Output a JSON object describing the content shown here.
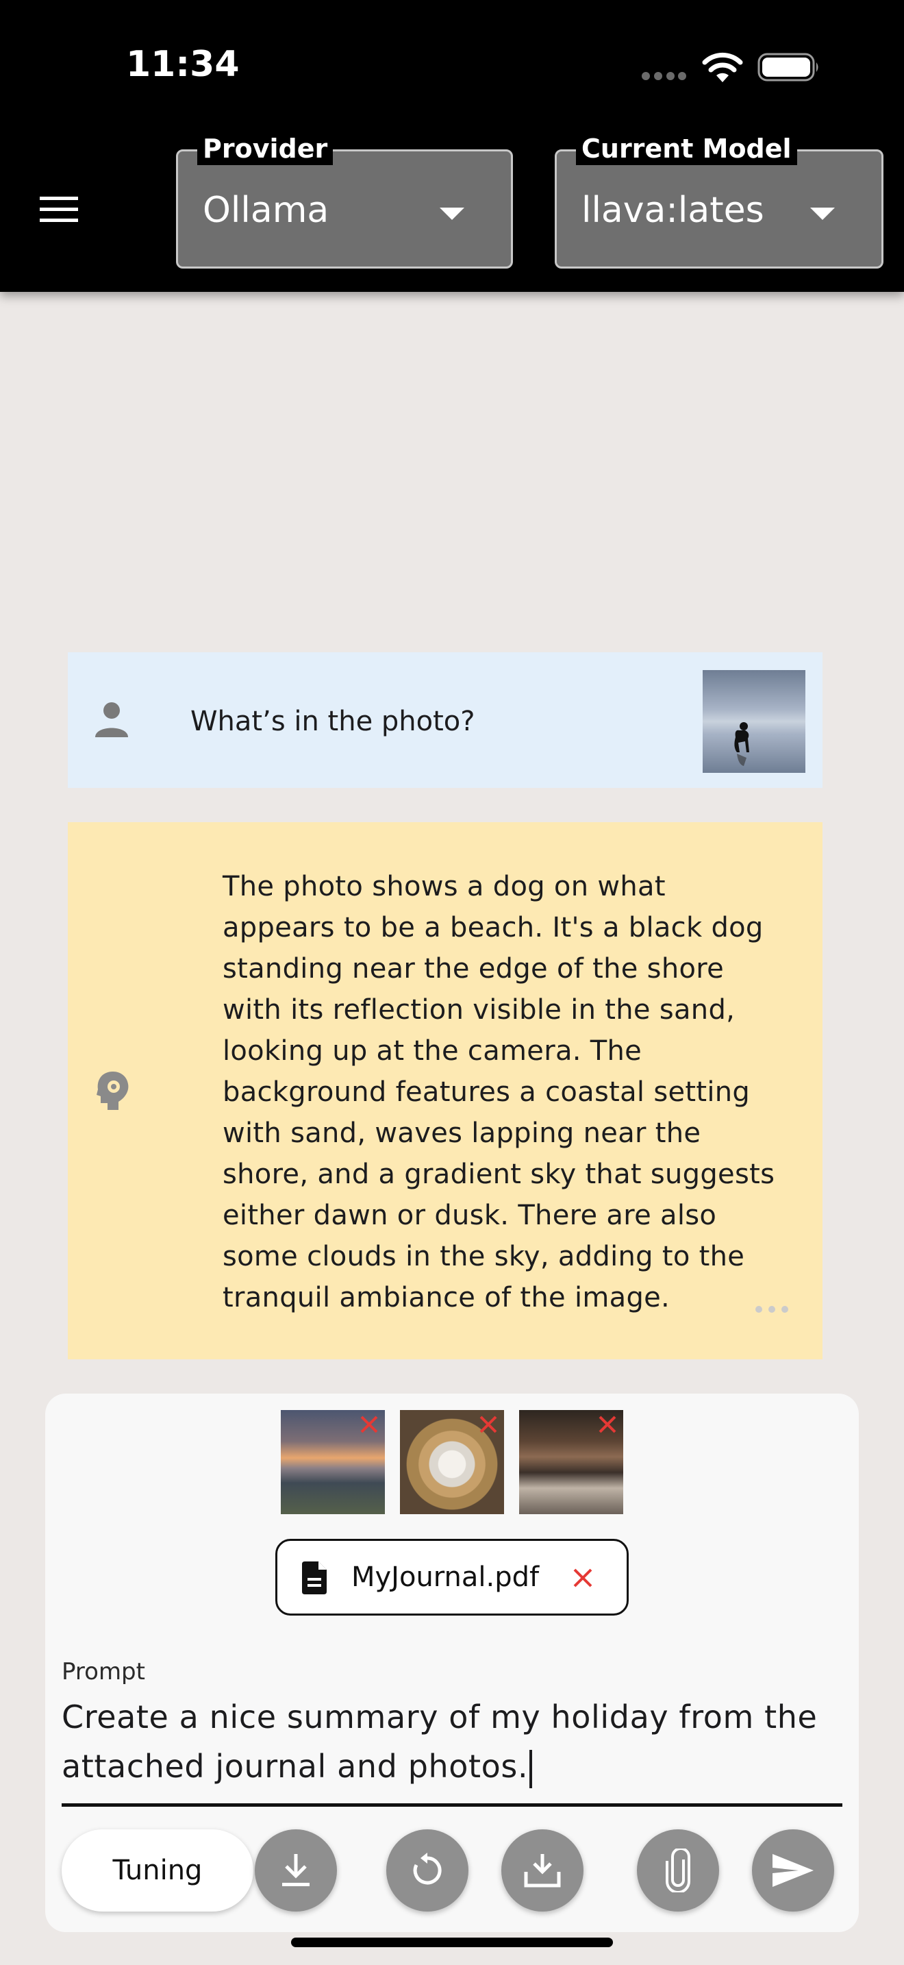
{
  "status_bar": {
    "time": "11:34"
  },
  "app_bar": {
    "provider": {
      "label": "Provider",
      "value": "Ollama"
    },
    "model": {
      "label": "Current Model",
      "value": "llava:lates"
    }
  },
  "messages": [
    {
      "role": "user",
      "text": "What’s in the photo?"
    },
    {
      "role": "assistant",
      "text": "The photo shows a dog on what\nappears to be a beach. It's a black dog\nstanding near the edge of the shore\nwith its reflection visible in the sand,\nlooking up at the camera. The\nbackground features a coastal setting\nwith sand, waves lapping near the\nshore, and a gradient sky that suggests\neither dawn or dusk. There are also\nsome clouds in the sky, adding to the\ntranquil ambiance of the image."
    }
  ],
  "composer": {
    "attachment_file": "MyJournal.pdf",
    "prompt_label": "Prompt",
    "prompt_value": "Create a nice summary of my holiday from the attached journal and photos.",
    "tuning_label": "Tuning"
  },
  "colors": {
    "app_bar": "#000000",
    "user_bubble": "#e3effa",
    "assistant_bubble": "#fde9b3",
    "remove_icon": "#e53935",
    "action_button": "#8f8f8f"
  },
  "icons": [
    "menu-icon",
    "dropdown-caret-icon",
    "person-icon",
    "ai-brain-icon",
    "more-icon",
    "close-icon",
    "document-icon",
    "download-icon",
    "refresh-icon",
    "save-icon",
    "attach-icon",
    "send-icon"
  ]
}
